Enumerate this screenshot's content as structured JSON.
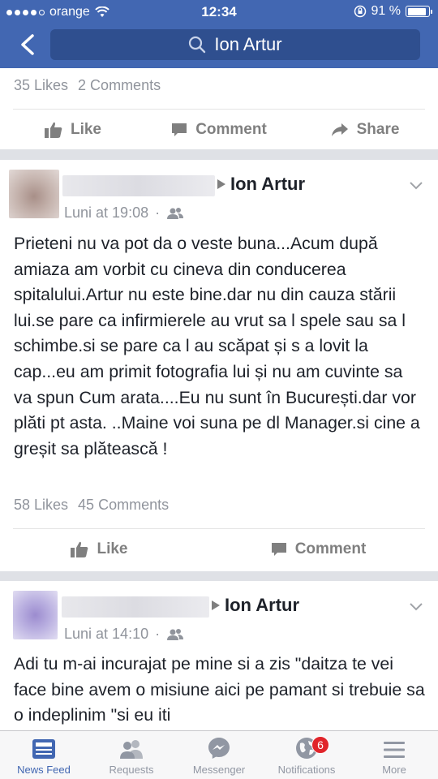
{
  "status_bar": {
    "carrier": "orange",
    "time": "12:34",
    "battery": "91 %"
  },
  "header": {
    "search_value": "Ion Artur"
  },
  "top_post": {
    "likes": "35 Likes",
    "comments": "2 Comments",
    "actions": {
      "like": "Like",
      "comment": "Comment",
      "share": "Share"
    }
  },
  "posts": [
    {
      "author": "Ion Artur",
      "time": "Luni at 19:08",
      "text": "Prieteni nu va pot da o veste buna...Acum după amiaza am vorbit cu cineva din conducerea spitalului.Artur nu este bine.dar nu din cauza stării lui.se pare ca infirmierele au vrut sa l spele sau sa l schimbe.si se pare ca l au scăpat și s a lovit la cap...eu am primit fotografia lui și nu am cuvinte sa va spun Cum arata....Eu nu sunt în București.dar vor plăti pt asta. ..Maine voi suna pe dl Manager.si cine a greșit sa plătească !",
      "likes": "58 Likes",
      "comments": "45 Comments",
      "actions": {
        "like": "Like",
        "comment": "Comment"
      }
    },
    {
      "author": "Ion Artur",
      "time": "Luni at 14:10",
      "text": "Adi tu m-ai incurajat pe mine si a zis \"daitza te vei face bine avem o misiune aici pe pamant si trebuie sa o indeplinim \"si eu iti"
    }
  ],
  "tabbar": {
    "tabs": [
      {
        "label": "News Feed",
        "icon": "news-feed-icon"
      },
      {
        "label": "Requests",
        "icon": "friend-requests-icon"
      },
      {
        "label": "Messenger",
        "icon": "messenger-icon"
      },
      {
        "label": "Notifications",
        "icon": "globe-icon",
        "badge": "6"
      },
      {
        "label": "More",
        "icon": "menu-icon"
      }
    ]
  },
  "colors": {
    "brand": "#4267b2",
    "search_bg": "#2f4f8f",
    "badge": "#e0242a"
  }
}
